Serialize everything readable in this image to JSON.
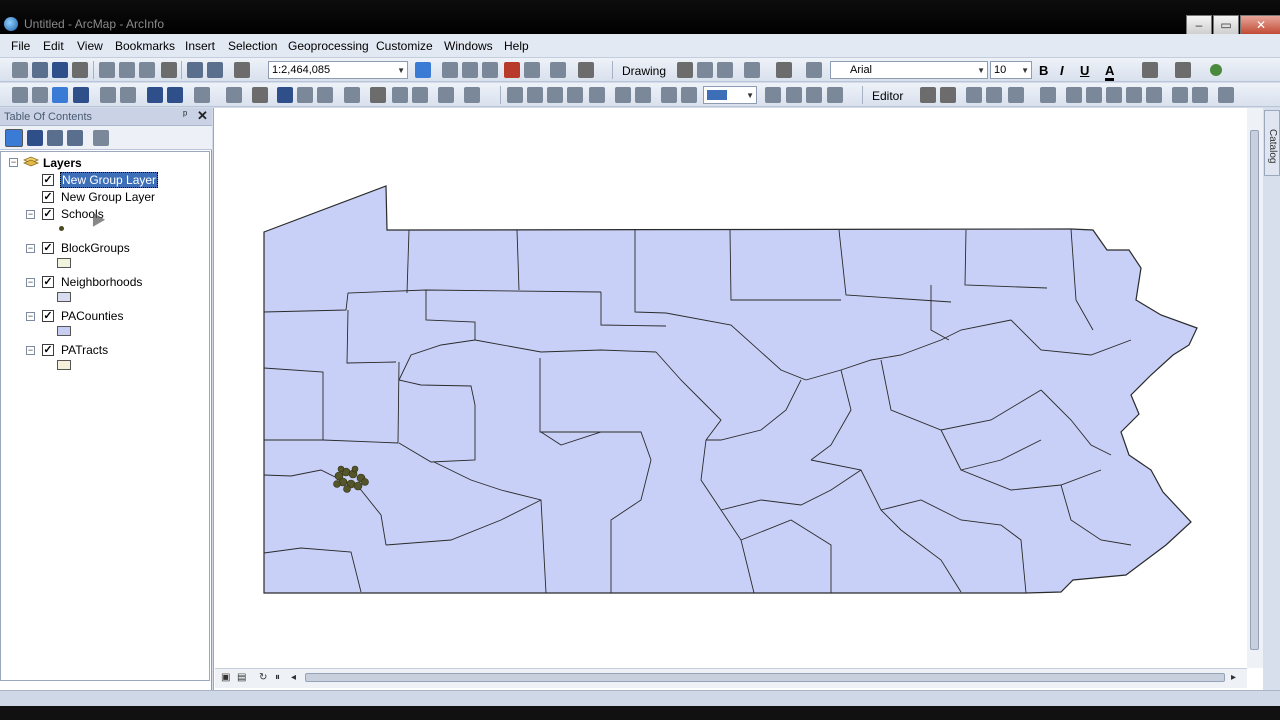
{
  "window": {
    "title": "Untitled - ArcMap - ArcInfo",
    "controls": [
      "–",
      "▭",
      "✕"
    ]
  },
  "menu": [
    "File",
    "Edit",
    "View",
    "Bookmarks",
    "Insert",
    "Selection",
    "Geoprocessing",
    "Customize",
    "Windows",
    "Help"
  ],
  "toolbar": {
    "scale": "1:2,464,085",
    "drawing_label": "Drawing",
    "font_name": "Arial",
    "font_size": "10",
    "bold": "B",
    "italic": "I",
    "underline": "U",
    "font_color_glyph": "A",
    "editor_label": "Editor",
    "unit_glyph": "A"
  },
  "toc": {
    "title": "Table Of Contents",
    "pin": "ᵖ",
    "close": "✕",
    "root": "Layers",
    "layers": [
      {
        "name": "New Group Layer",
        "checked": true,
        "selected": true
      },
      {
        "name": "New Group Layer",
        "checked": true,
        "selected": false
      },
      {
        "name": "Schools",
        "checked": true,
        "selected": false,
        "symbol": "point"
      },
      {
        "name": "BlockGroups",
        "checked": true,
        "selected": false,
        "symbol": "fill",
        "color": "#f1f3dc"
      },
      {
        "name": "Neighborhoods",
        "checked": true,
        "selected": false,
        "symbol": "fill",
        "color": "#d9dcef"
      },
      {
        "name": "PACounties",
        "checked": true,
        "selected": false,
        "symbol": "fill",
        "color": "#c8cdf2"
      },
      {
        "name": "PATracts",
        "checked": true,
        "selected": false,
        "symbol": "fill",
        "color": "#f4f0dc"
      }
    ]
  },
  "map": {
    "fill_color": "#c8d0f7",
    "outline_color": "#2a2a2a",
    "cluster_color": "#55552a"
  },
  "side_panel": {
    "catalog_label": "Catalog"
  }
}
